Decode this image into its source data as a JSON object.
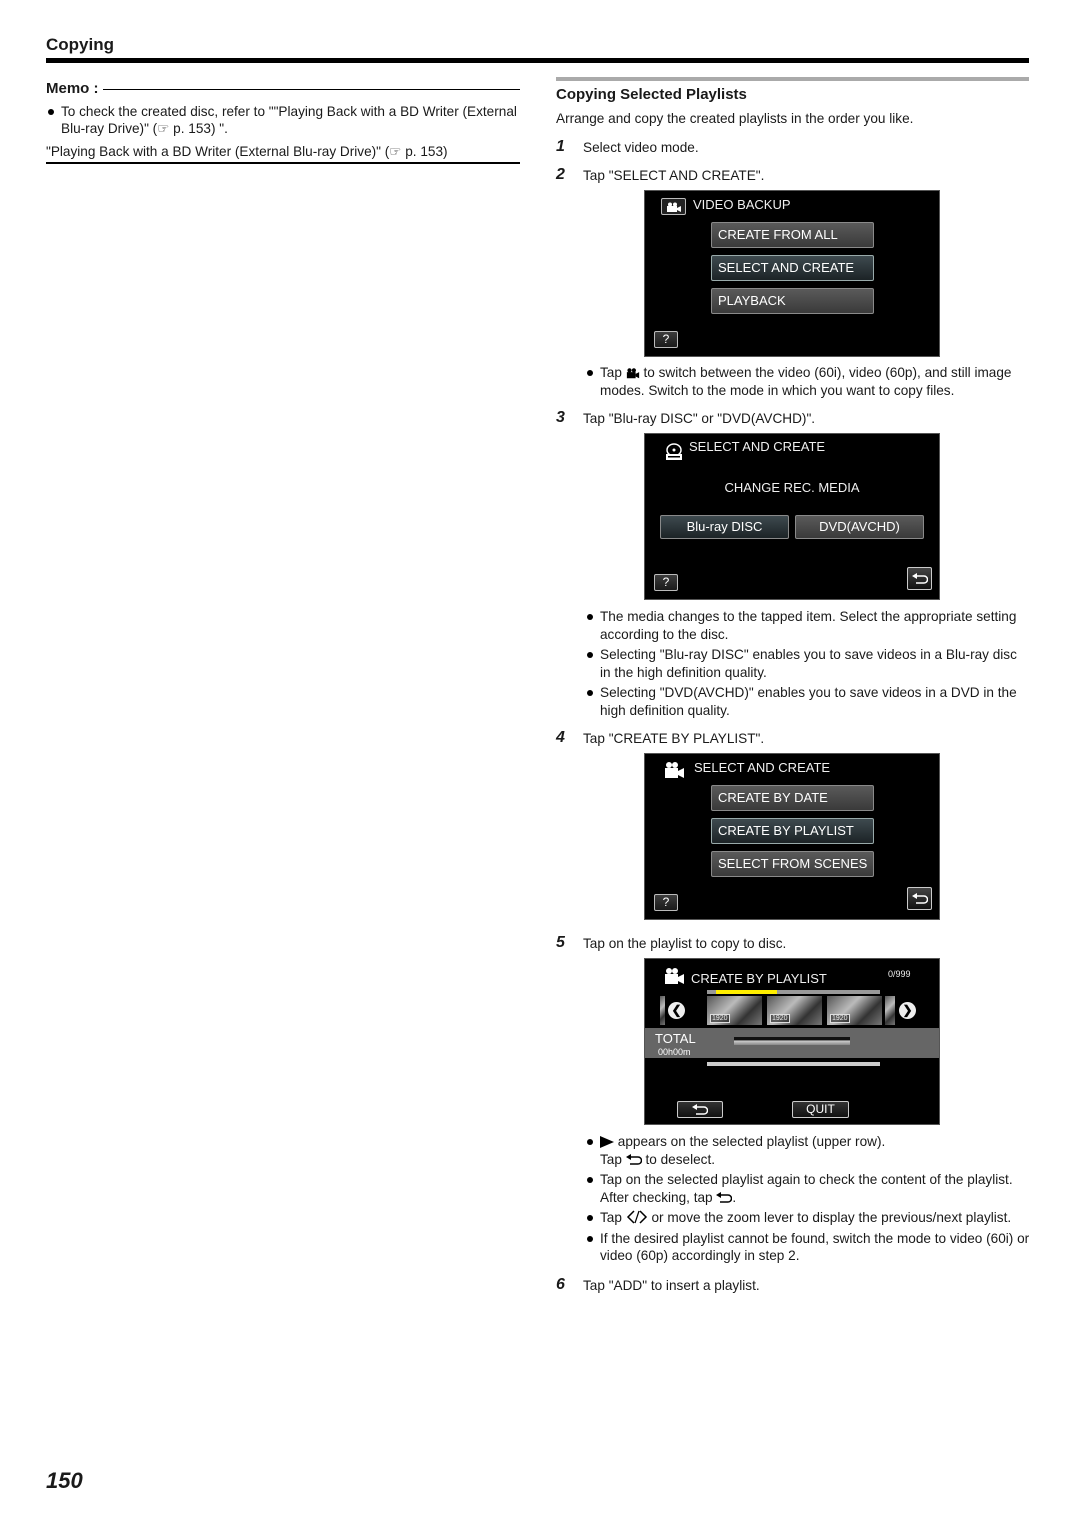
{
  "header": {
    "title": "Copying"
  },
  "memo": {
    "label": "Memo :",
    "bullet": "To check the created disc, refer to \"\"Playing Back with a BD Writer (External Blu-ray Drive)\" (☞ p. 153) \".",
    "link": "\"Playing Back with a BD Writer (External Blu-ray Drive)\" (☞ p. 153)"
  },
  "section": {
    "title": "Copying Selected Playlists",
    "intro": "Arrange and copy the created playlists in the order you like.",
    "steps": [
      {
        "num": "1",
        "text": "Select video mode."
      },
      {
        "num": "2",
        "text": "Tap \"SELECT AND CREATE\"."
      },
      {
        "num": "3",
        "text": "Tap \"Blu-ray DISC\" or \"DVD(AVCHD)\"."
      },
      {
        "num": "4",
        "text": "Tap \"CREATE BY PLAYLIST\"."
      },
      {
        "num": "5",
        "text": "Tap on the playlist to copy to disc."
      },
      {
        "num": "6",
        "text": "Tap \"ADD\" to insert a playlist."
      }
    ],
    "step2_notes": [
      {
        "pre": "Tap",
        "post": "to switch between the video (60i), video (60p), and still image modes. Switch to the mode in which you want to copy files."
      }
    ],
    "step3_notes": [
      "The media changes to the tapped item. Select the appropriate setting according to the disc.",
      "Selecting \"Blu-ray DISC\" enables you to save videos in a Blu-ray disc in the high definition quality.",
      "Selecting \"DVD(AVCHD)\" enables you to save videos in a DVD in the high definition quality."
    ],
    "step5_notes": {
      "n1_a": "appears on the selected playlist (upper row).",
      "n1_b_pre": "Tap",
      "n1_b_post": "to deselect.",
      "n2_a": "Tap on the selected playlist again to check the content of the playlist.",
      "n2_b": "After checking, tap",
      "n3_pre": "Tap",
      "n3_post": "or move the zoom lever to display the previous/next playlist.",
      "n4": "If the desired playlist cannot be found, switch the mode to video (60i) or video (60p) accordingly in step 2."
    }
  },
  "screens": {
    "video_backup": {
      "title": "VIDEO BACKUP",
      "buttons": [
        "CREATE FROM ALL",
        "SELECT AND CREATE",
        "PLAYBACK"
      ],
      "selected": "SELECT AND CREATE",
      "help": "?"
    },
    "select_media": {
      "title": "SELECT AND CREATE",
      "subtitle": "CHANGE REC. MEDIA",
      "options": [
        "Blu-ray DISC",
        "DVD(AVCHD)"
      ],
      "selected": "Blu-ray DISC",
      "help": "?"
    },
    "select_create": {
      "title": "SELECT AND CREATE",
      "buttons": [
        "CREATE BY DATE",
        "CREATE BY PLAYLIST",
        "SELECT FROM SCENES"
      ],
      "selected": "CREATE BY PLAYLIST",
      "help": "?"
    },
    "create_by_playlist": {
      "title": "CREATE BY PLAYLIST",
      "counter": "0/999",
      "scroll_position_fraction": 0.35,
      "thumb_tags": [
        "1920",
        "1920",
        "1920"
      ],
      "total_label": "TOTAL",
      "total_time": "00h00m",
      "quit": "QUIT",
      "colors": {
        "scroll_highlight": "#ffee00"
      }
    }
  },
  "page_number": "150"
}
